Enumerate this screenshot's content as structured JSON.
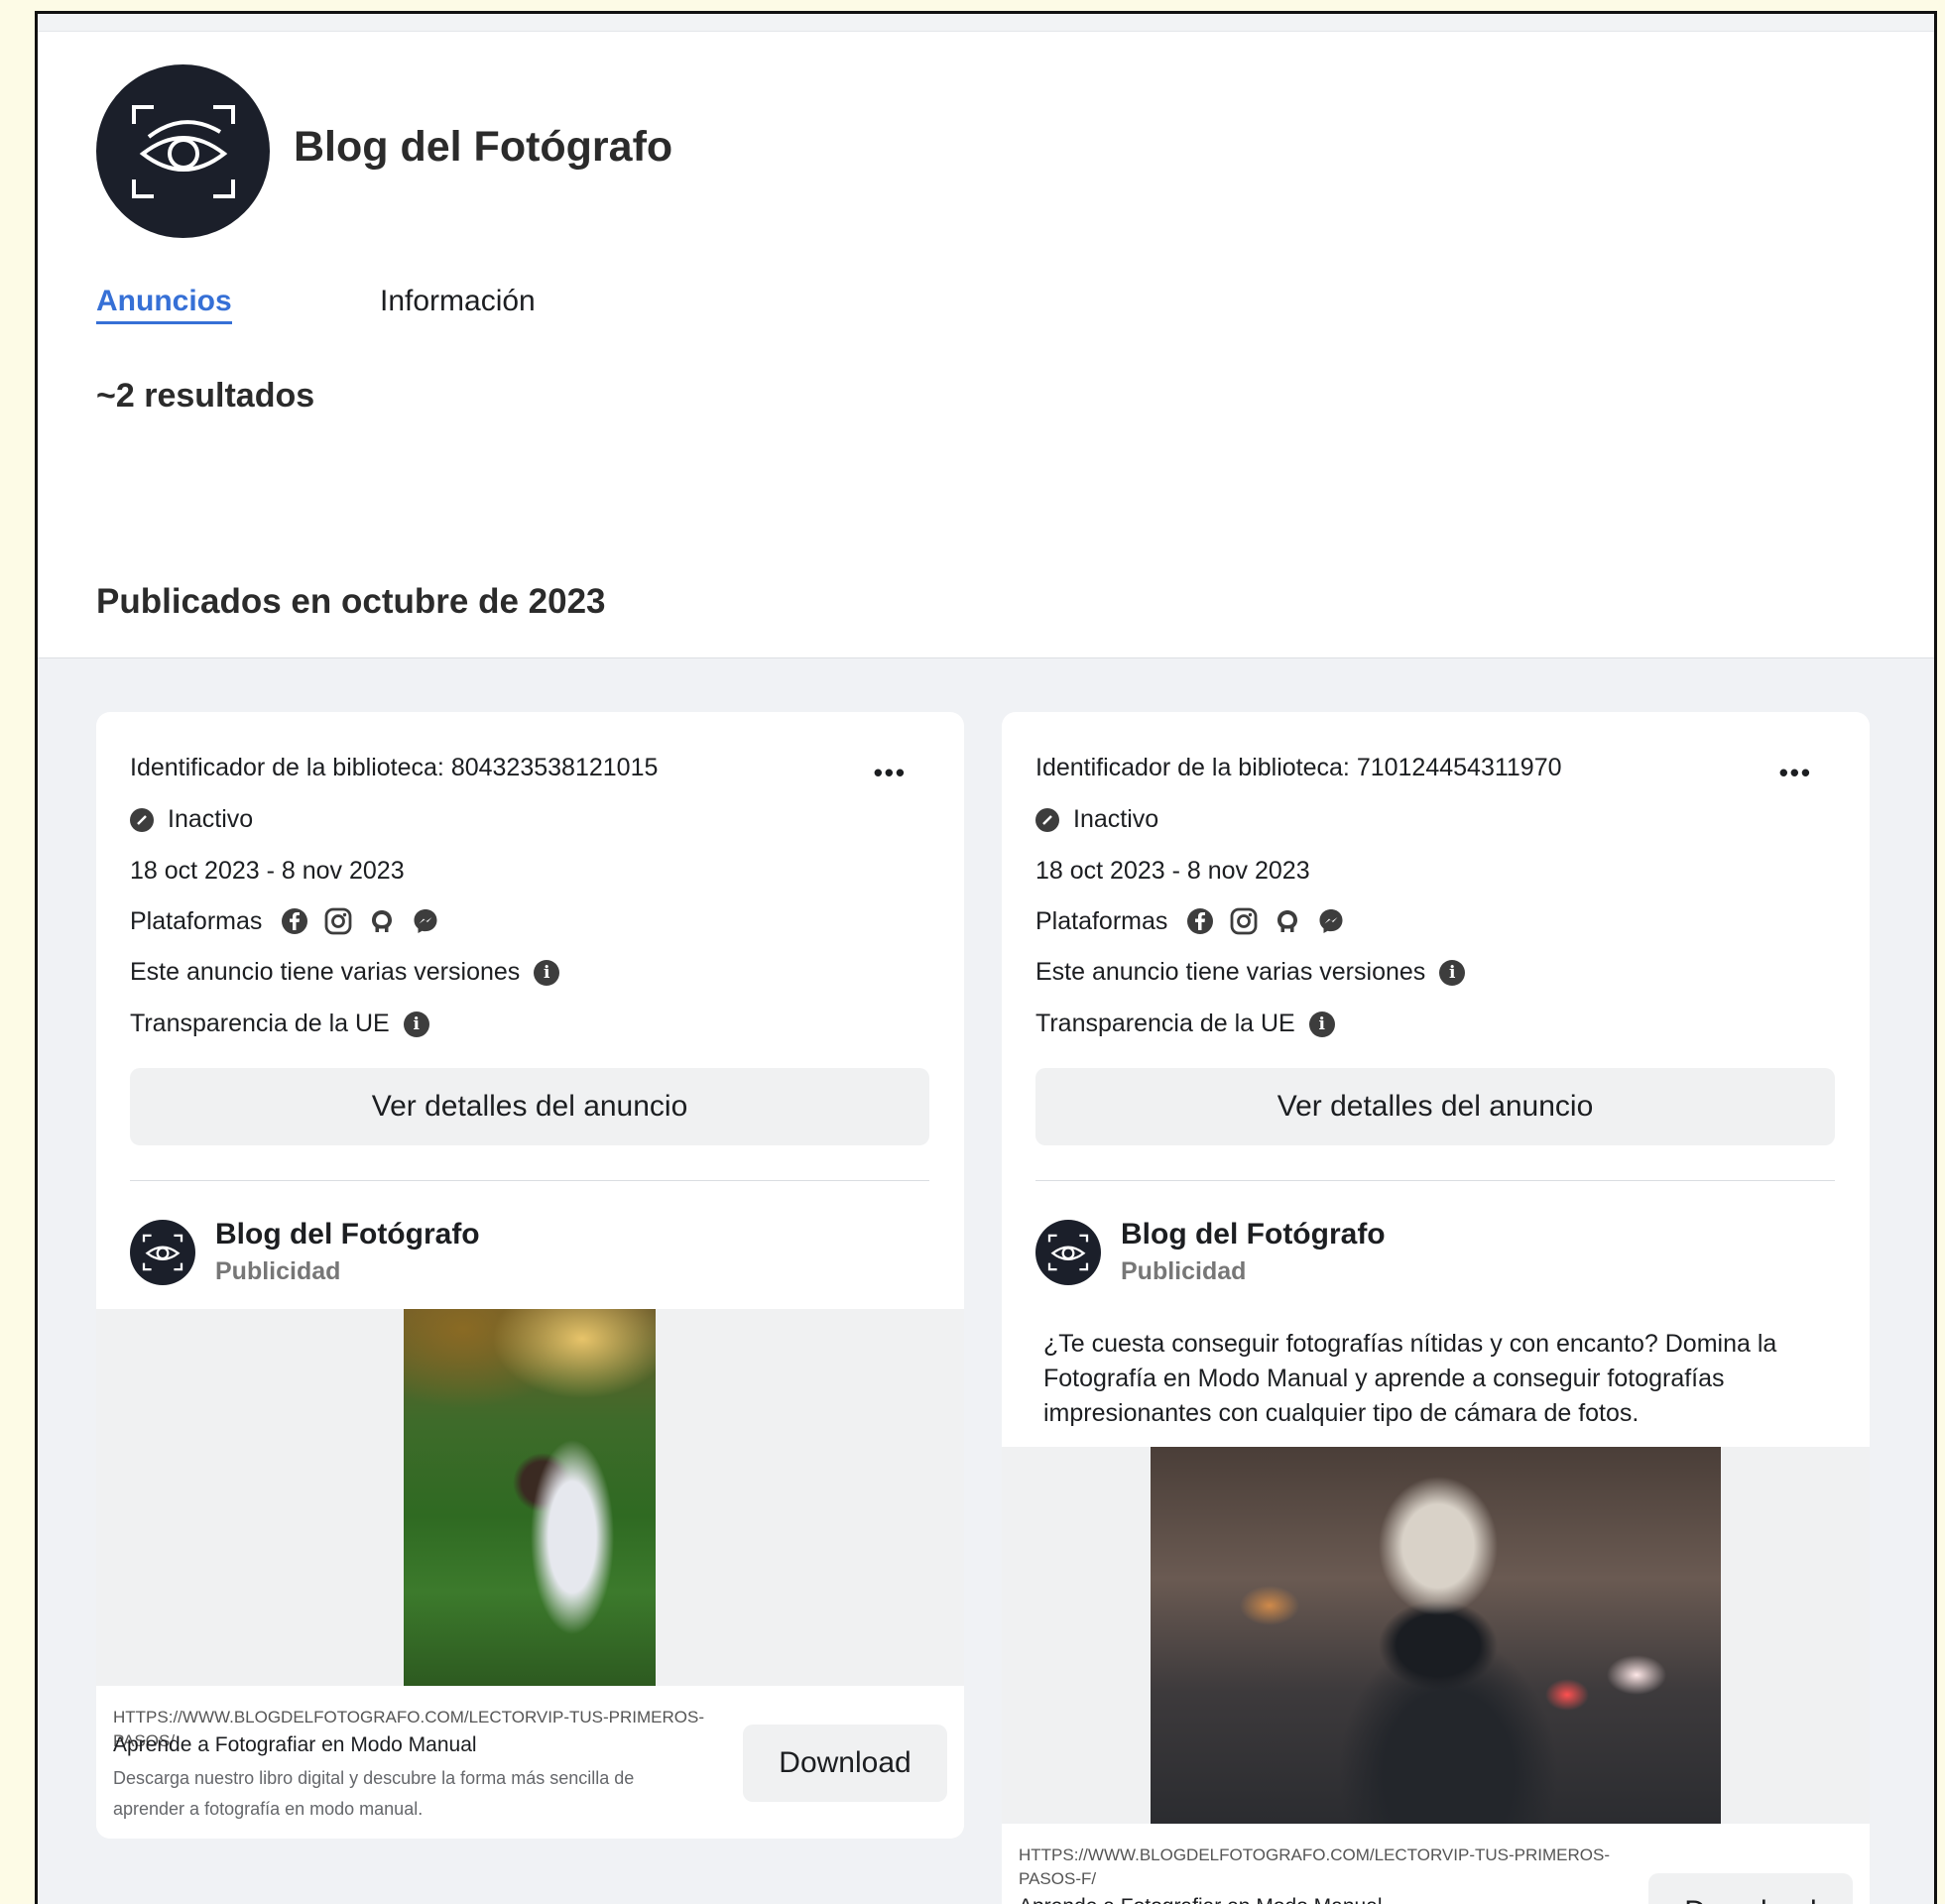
{
  "page": {
    "name": "Blog del Fotógrafo",
    "tabs": [
      {
        "label": "Anuncios"
      },
      {
        "label": "Información"
      }
    ],
    "results": "~2 resultados",
    "section_title": "Publicados en octubre de 2023"
  },
  "ads": [
    {
      "library_id": "Identificador de la biblioteca: 804323538121015",
      "more_label": "•••",
      "status": "Inactivo",
      "dates": "18 oct 2023 - 8 nov 2023",
      "platforms_label": "Plataformas",
      "platform_icons": [
        "facebook-icon",
        "instagram-icon",
        "audience-network-icon",
        "messenger-icon"
      ],
      "versions_label": "Este anuncio tiene varias versiones",
      "transparency_label": "Transparencia de la UE",
      "details_button": "Ver detalles del anuncio",
      "advertiser": "Blog del Fotógrafo",
      "advertiser_sub": "Publicidad",
      "body_text": "",
      "link_url": "HTTPS://WWW.BLOGDELFOTOGRAFO.COM/LECTORVIP-TUS-PRIMEROS-PASOS/",
      "link_title": "Aprende a Fotografiar en Modo Manual",
      "link_desc": "Descarga nuestro libro digital y descubre la forma más sencilla de aprender a fotografía en modo manual.",
      "cta": "Download"
    },
    {
      "library_id": "Identificador de la biblioteca: 710124454311970",
      "more_label": "•••",
      "status": "Inactivo",
      "dates": "18 oct 2023 - 8 nov 2023",
      "platforms_label": "Plataformas",
      "platform_icons": [
        "facebook-icon",
        "instagram-icon",
        "audience-network-icon",
        "messenger-icon"
      ],
      "versions_label": "Este anuncio tiene varias versiones",
      "transparency_label": "Transparencia de la UE",
      "details_button": "Ver detalles del anuncio",
      "advertiser": "Blog del Fotógrafo",
      "advertiser_sub": "Publicidad",
      "body_text": "¿Te cuesta conseguir fotografías nítidas y con encanto? Domina la Fotografía en Modo Manual y aprende a conseguir fotografías impresionantes con cualquier tipo de cámara de fotos.",
      "link_url": "HTTPS://WWW.BLOGDELFOTOGRAFO.COM/LECTORVIP-TUS-PRIMEROS-PASOS-F/",
      "link_title": "Aprende a Fotografiar en Modo Manual",
      "cta": "Download"
    }
  ],
  "colors": {
    "accent": "#3670d6",
    "avatar_bg": "#1b1f2a",
    "page_bg": "#f0f2f5"
  }
}
